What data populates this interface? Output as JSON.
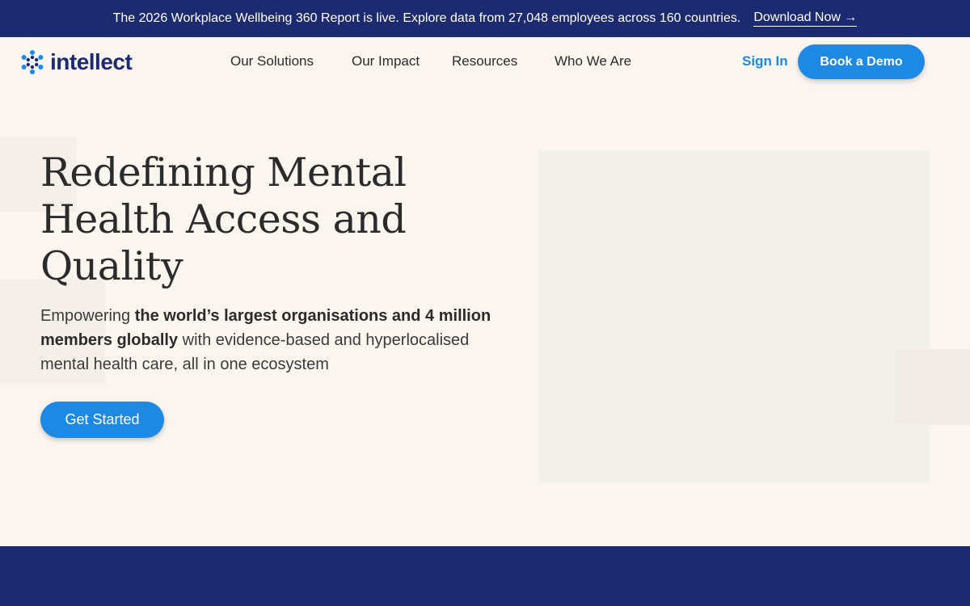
{
  "announcement": {
    "message": "The 2026 Workplace Wellbeing 360 Report is live. Explore data from 27,048 employees across 160 countries.",
    "link_label": "Download Now →"
  },
  "header": {
    "logo_text": "intellect",
    "logo_icon": "asterisk-dots-logo-icon",
    "nav": [
      {
        "label": "Our Solutions"
      },
      {
        "label": "Our Impact"
      },
      {
        "label": "Resources"
      },
      {
        "label": "Who We Are"
      }
    ],
    "sign_in_label": "Sign In",
    "demo_label": "Book a Demo"
  },
  "hero": {
    "title": "Redefining Mental Health Access and Quality",
    "subtitle_prefix": "Empowering ",
    "subtitle_bold": "the world’s largest organisations and 4 million members globally",
    "subtitle_suffix": " with evidence-based and hyperlocalised mental health care, all in one ecosystem",
    "cta_label": "Get Started"
  },
  "colors": {
    "brand_navy": "#1c2b70",
    "accent_blue": "#1e88e5",
    "background": "#faf5ef"
  }
}
